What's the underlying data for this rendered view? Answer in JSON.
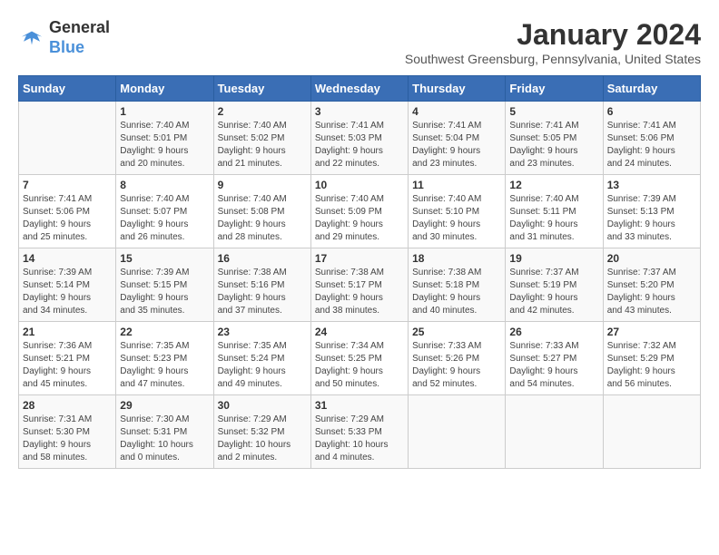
{
  "header": {
    "logo_line1": "General",
    "logo_line2": "Blue",
    "title": "January 2024",
    "subtitle": "Southwest Greensburg, Pennsylvania, United States"
  },
  "days_of_week": [
    "Sunday",
    "Monday",
    "Tuesday",
    "Wednesday",
    "Thursday",
    "Friday",
    "Saturday"
  ],
  "weeks": [
    [
      {
        "day": "",
        "info": ""
      },
      {
        "day": "1",
        "info": "Sunrise: 7:40 AM\nSunset: 5:01 PM\nDaylight: 9 hours\nand 20 minutes."
      },
      {
        "day": "2",
        "info": "Sunrise: 7:40 AM\nSunset: 5:02 PM\nDaylight: 9 hours\nand 21 minutes."
      },
      {
        "day": "3",
        "info": "Sunrise: 7:41 AM\nSunset: 5:03 PM\nDaylight: 9 hours\nand 22 minutes."
      },
      {
        "day": "4",
        "info": "Sunrise: 7:41 AM\nSunset: 5:04 PM\nDaylight: 9 hours\nand 23 minutes."
      },
      {
        "day": "5",
        "info": "Sunrise: 7:41 AM\nSunset: 5:05 PM\nDaylight: 9 hours\nand 23 minutes."
      },
      {
        "day": "6",
        "info": "Sunrise: 7:41 AM\nSunset: 5:06 PM\nDaylight: 9 hours\nand 24 minutes."
      }
    ],
    [
      {
        "day": "7",
        "info": "Sunrise: 7:41 AM\nSunset: 5:06 PM\nDaylight: 9 hours\nand 25 minutes."
      },
      {
        "day": "8",
        "info": "Sunrise: 7:40 AM\nSunset: 5:07 PM\nDaylight: 9 hours\nand 26 minutes."
      },
      {
        "day": "9",
        "info": "Sunrise: 7:40 AM\nSunset: 5:08 PM\nDaylight: 9 hours\nand 28 minutes."
      },
      {
        "day": "10",
        "info": "Sunrise: 7:40 AM\nSunset: 5:09 PM\nDaylight: 9 hours\nand 29 minutes."
      },
      {
        "day": "11",
        "info": "Sunrise: 7:40 AM\nSunset: 5:10 PM\nDaylight: 9 hours\nand 30 minutes."
      },
      {
        "day": "12",
        "info": "Sunrise: 7:40 AM\nSunset: 5:11 PM\nDaylight: 9 hours\nand 31 minutes."
      },
      {
        "day": "13",
        "info": "Sunrise: 7:39 AM\nSunset: 5:13 PM\nDaylight: 9 hours\nand 33 minutes."
      }
    ],
    [
      {
        "day": "14",
        "info": "Sunrise: 7:39 AM\nSunset: 5:14 PM\nDaylight: 9 hours\nand 34 minutes."
      },
      {
        "day": "15",
        "info": "Sunrise: 7:39 AM\nSunset: 5:15 PM\nDaylight: 9 hours\nand 35 minutes."
      },
      {
        "day": "16",
        "info": "Sunrise: 7:38 AM\nSunset: 5:16 PM\nDaylight: 9 hours\nand 37 minutes."
      },
      {
        "day": "17",
        "info": "Sunrise: 7:38 AM\nSunset: 5:17 PM\nDaylight: 9 hours\nand 38 minutes."
      },
      {
        "day": "18",
        "info": "Sunrise: 7:38 AM\nSunset: 5:18 PM\nDaylight: 9 hours\nand 40 minutes."
      },
      {
        "day": "19",
        "info": "Sunrise: 7:37 AM\nSunset: 5:19 PM\nDaylight: 9 hours\nand 42 minutes."
      },
      {
        "day": "20",
        "info": "Sunrise: 7:37 AM\nSunset: 5:20 PM\nDaylight: 9 hours\nand 43 minutes."
      }
    ],
    [
      {
        "day": "21",
        "info": "Sunrise: 7:36 AM\nSunset: 5:21 PM\nDaylight: 9 hours\nand 45 minutes."
      },
      {
        "day": "22",
        "info": "Sunrise: 7:35 AM\nSunset: 5:23 PM\nDaylight: 9 hours\nand 47 minutes."
      },
      {
        "day": "23",
        "info": "Sunrise: 7:35 AM\nSunset: 5:24 PM\nDaylight: 9 hours\nand 49 minutes."
      },
      {
        "day": "24",
        "info": "Sunrise: 7:34 AM\nSunset: 5:25 PM\nDaylight: 9 hours\nand 50 minutes."
      },
      {
        "day": "25",
        "info": "Sunrise: 7:33 AM\nSunset: 5:26 PM\nDaylight: 9 hours\nand 52 minutes."
      },
      {
        "day": "26",
        "info": "Sunrise: 7:33 AM\nSunset: 5:27 PM\nDaylight: 9 hours\nand 54 minutes."
      },
      {
        "day": "27",
        "info": "Sunrise: 7:32 AM\nSunset: 5:29 PM\nDaylight: 9 hours\nand 56 minutes."
      }
    ],
    [
      {
        "day": "28",
        "info": "Sunrise: 7:31 AM\nSunset: 5:30 PM\nDaylight: 9 hours\nand 58 minutes."
      },
      {
        "day": "29",
        "info": "Sunrise: 7:30 AM\nSunset: 5:31 PM\nDaylight: 10 hours\nand 0 minutes."
      },
      {
        "day": "30",
        "info": "Sunrise: 7:29 AM\nSunset: 5:32 PM\nDaylight: 10 hours\nand 2 minutes."
      },
      {
        "day": "31",
        "info": "Sunrise: 7:29 AM\nSunset: 5:33 PM\nDaylight: 10 hours\nand 4 minutes."
      },
      {
        "day": "",
        "info": ""
      },
      {
        "day": "",
        "info": ""
      },
      {
        "day": "",
        "info": ""
      }
    ]
  ]
}
